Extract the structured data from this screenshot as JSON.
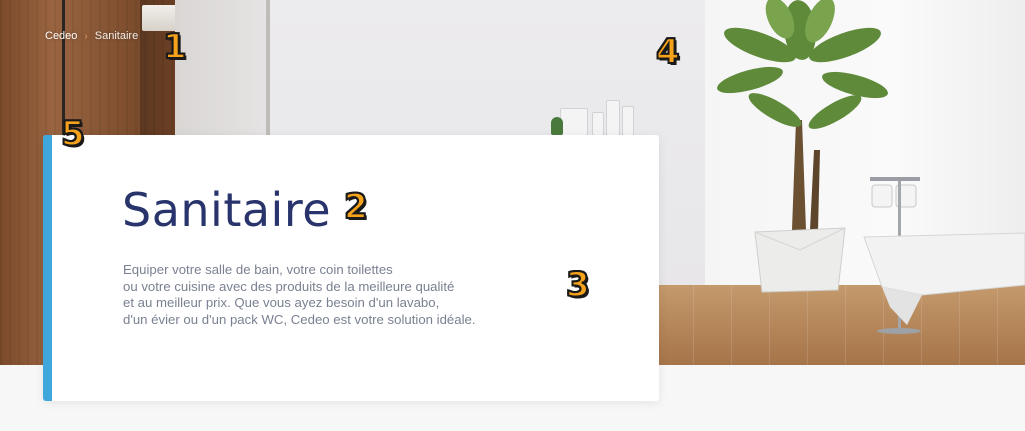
{
  "breadcrumb": {
    "home_label": "Cedeo",
    "separator": "›",
    "current_label": "Sanitaire"
  },
  "hero": {
    "title": "Sanitaire",
    "description_lines": [
      "Equiper votre salle de bain, votre coin toilettes",
      "ou votre cuisine avec des produits de la meilleure qualité",
      "et au meilleur prix. Que vous ayez besoin d'un lavabo,",
      "d'un évier ou d'un pack WC, Cedeo est votre solution idéale."
    ],
    "image": "bathroom-hero-photo"
  },
  "annotations": [
    "1",
    "2",
    "3",
    "4",
    "5"
  ],
  "colors": {
    "title": "#28346b",
    "accent_bar": "#3fa7dc",
    "description": "#7a8091",
    "marker": "#f7a21b",
    "breadcrumb_separator": "#e7a06b"
  }
}
